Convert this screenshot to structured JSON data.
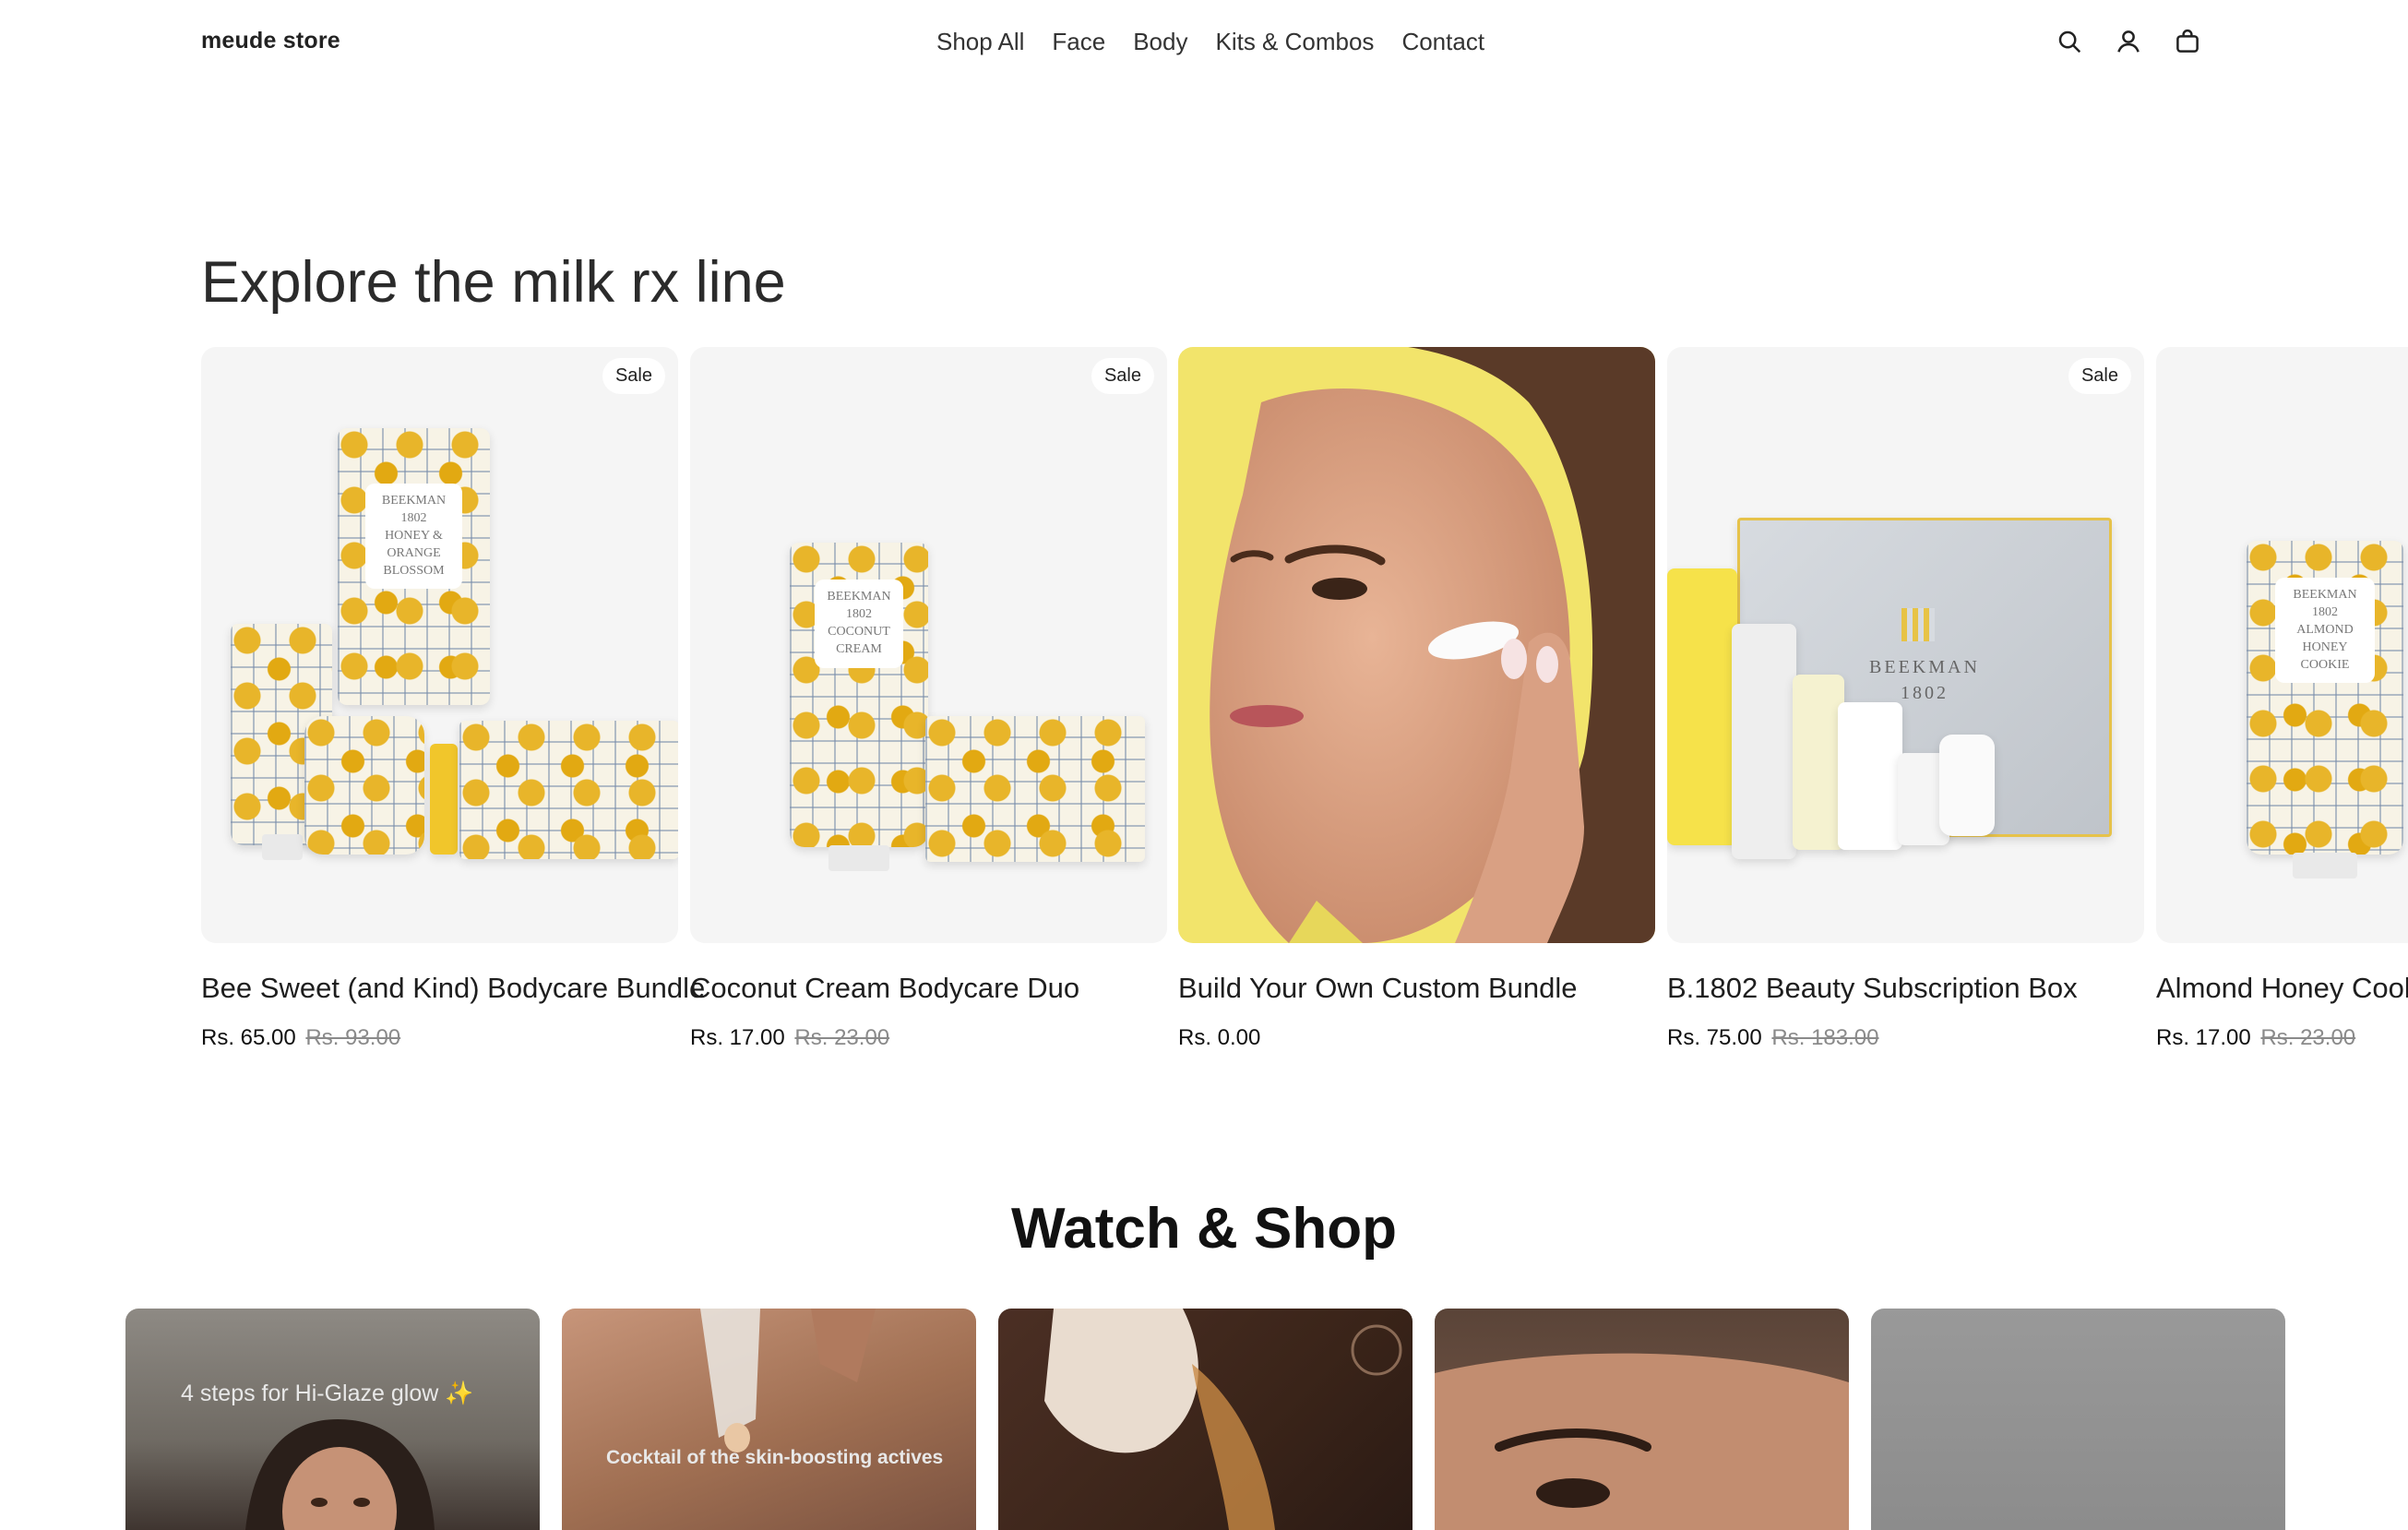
{
  "store": {
    "name": "meude store"
  },
  "nav": {
    "items": [
      "Shop All",
      "Face",
      "Body",
      "Kits & Combos",
      "Contact"
    ]
  },
  "header_icons": [
    "search-icon",
    "account-icon",
    "cart-icon"
  ],
  "collection": {
    "title": "Explore the milk rx line",
    "products": [
      {
        "name": "Bee Sweet (and Kind) Bodycare Bundle",
        "price": "Rs. 65.00",
        "compare_price": "Rs. 93.00",
        "badge": "Sale",
        "label_lines": [
          "BEEKMAN",
          "1802",
          "HONEY &",
          "ORANGE",
          "BLOSSOM"
        ]
      },
      {
        "name": "Coconut Cream Bodycare Duo",
        "price": "Rs. 17.00",
        "compare_price": "Rs. 23.00",
        "badge": "Sale",
        "label_lines": [
          "BEEKMAN",
          "1802",
          "COCONUT",
          "CREAM"
        ]
      },
      {
        "name": "Build Your Own Custom Bundle",
        "price": "Rs. 0.00",
        "compare_price": "",
        "badge": ""
      },
      {
        "name": "B.1802 Beauty Subscription Box",
        "price": "Rs. 75.00",
        "compare_price": "Rs. 183.00",
        "badge": "Sale",
        "label_lines": [
          "BEEKMAN",
          "1802"
        ]
      },
      {
        "name": "Almond Honey Cookie Bodycare Duo",
        "price": "Rs. 17.00",
        "compare_price": "Rs. 23.00",
        "badge": "",
        "label_lines": [
          "BEEKMAN",
          "1802",
          "ALMOND HONEY",
          "COOKIE"
        ]
      }
    ]
  },
  "watch": {
    "title": "Watch & Shop",
    "videos": [
      {
        "caption": "4 steps for Hi-Glaze glow ✨"
      },
      {
        "caption": "Cocktail of the skin-boosting actives"
      },
      {
        "caption": ""
      },
      {
        "caption": ""
      },
      {
        "caption": ""
      }
    ]
  },
  "colors": {
    "background": "#ffffff",
    "text": "#1a1a1a",
    "muted": "#8a8a8a",
    "card_bg": "#f5f5f5",
    "accent_yellow": "#f2e46b"
  }
}
